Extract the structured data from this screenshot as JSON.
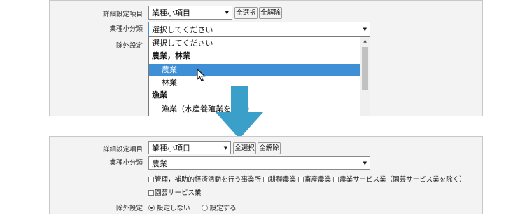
{
  "top": {
    "detail_label": "詳細設定項目",
    "detail_select": "業種小項目",
    "select_all": "全選択",
    "deselect_all": "全解除",
    "industry_label": "業種小分類",
    "industry_select": "選択してください",
    "exclude_label": "除外設定",
    "options": [
      {
        "text": "選択してください",
        "kind": "plain"
      },
      {
        "text": "農業，林業",
        "kind": "grp"
      },
      {
        "text": "農業",
        "kind": "item",
        "highlighted": true
      },
      {
        "text": "林業",
        "kind": "item"
      },
      {
        "text": "漁業",
        "kind": "grp"
      },
      {
        "text": "漁業（水産養殖業を除く）",
        "kind": "item"
      }
    ]
  },
  "arrow": {
    "color": "#3aa0c9"
  },
  "bottom": {
    "detail_label": "詳細設定項目",
    "detail_select": "業種小項目",
    "select_all": "全選択",
    "deselect_all": "全解除",
    "industry_label": "業種小分類",
    "industry_select": "農業",
    "checkboxes_row1": [
      "管理，補助的経済活動を行う事業所",
      "耕種農業",
      "畜産農業",
      "農業サービス業（園芸サービス業を除く）"
    ],
    "checkboxes_row2": [
      "園芸サービス業"
    ],
    "exclude_label": "除外設定",
    "radio_off": "設定しない",
    "radio_on": "設定する"
  }
}
